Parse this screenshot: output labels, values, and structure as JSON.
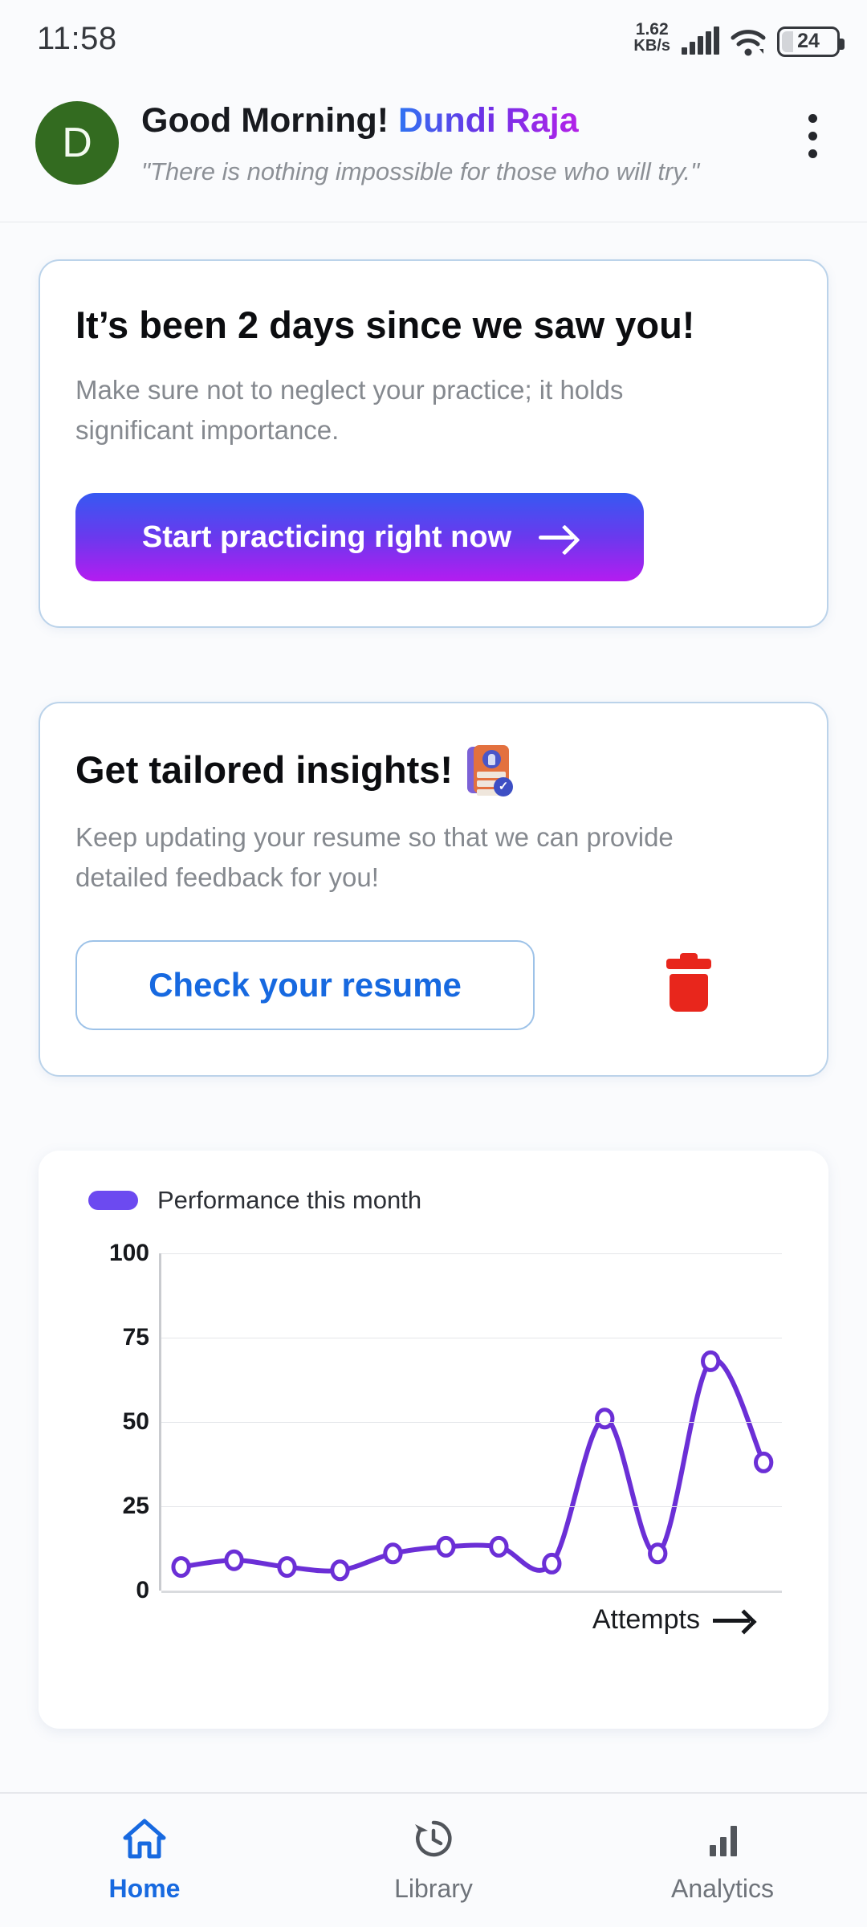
{
  "statusbar": {
    "time": "11:58",
    "net_speed_value": "1.62",
    "net_speed_unit": "KB/s",
    "battery_level": "24",
    "signal_icon": "signal-bars-icon",
    "wifi_icon": "wifi-icon"
  },
  "header": {
    "avatar_initial": "D",
    "avatar_color": "#336B20",
    "greeting": "Good Morning!",
    "user_name": "Dundi Raja",
    "quote": "\"There is nothing impossible for those who will try.\"",
    "menu_icon": "overflow-menu-icon"
  },
  "practice_card": {
    "title": "It’s been 2 days since we saw you!",
    "subtitle": "Make sure not to neglect your practice; it holds significant importance.",
    "cta_label": "Start practicing right now",
    "cta_icon": "arrow-right-icon",
    "cta_gradient_from": "#3659F2",
    "cta_gradient_to": "#B41CF0"
  },
  "resume_card": {
    "title": "Get tailored insights!",
    "title_icon": "resume-card-icon",
    "subtitle": "Keep updating your resume so that we can provide detailed feedback for you!",
    "cta_label": "Check your resume",
    "cta_color": "#1769E0",
    "delete_icon": "trash-icon",
    "delete_color": "#E8261C"
  },
  "chart_data": {
    "type": "line",
    "title": "Performance this month",
    "legend": [
      "Performance this month"
    ],
    "legend_position": "top-left",
    "legend_color": "#6C4AF0",
    "line_color": "#6B2FD6",
    "xlabel": "Attempts",
    "xlabel_arrow": "arrow-right-icon",
    "ylabel": "",
    "ylim": [
      0,
      100
    ],
    "yticks": [
      0,
      25,
      50,
      75,
      100
    ],
    "ytick_labels": [
      "0",
      "25",
      "50",
      "75",
      "100"
    ],
    "grid": true,
    "x": [
      1,
      2,
      3,
      4,
      5,
      6,
      7,
      8,
      9,
      10,
      11,
      12
    ],
    "values": [
      7,
      9,
      7,
      6,
      11,
      13,
      13,
      8,
      51,
      11,
      68,
      38
    ],
    "markers": "open-circle"
  },
  "bottom_nav": {
    "items": [
      {
        "label": "Home",
        "icon": "home-icon",
        "active": true
      },
      {
        "label": "Library",
        "icon": "history-clock-icon",
        "active": false
      },
      {
        "label": "Analytics",
        "icon": "bar-chart-icon",
        "active": false
      }
    ],
    "active_color": "#1769E0",
    "inactive_color": "#6E737A"
  }
}
